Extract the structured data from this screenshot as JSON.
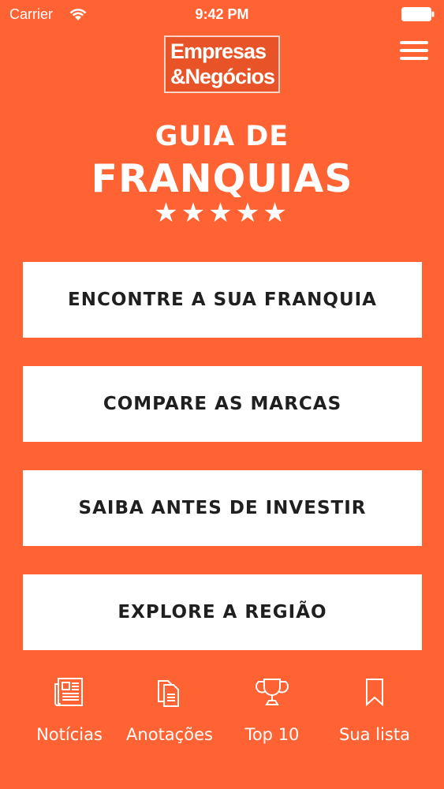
{
  "status_bar": {
    "carrier": "Carrier",
    "time": "9:42 PM"
  },
  "header": {
    "logo_line1": "Empresas",
    "logo_line2": "&Negócios"
  },
  "title": {
    "line1": "GUIA DE",
    "line2": "FRANQUIAS",
    "stars": "★★★★★"
  },
  "actions": [
    {
      "label": "ENCONTRE A SUA FRANQUIA"
    },
    {
      "label": "COMPARE AS MARCAS"
    },
    {
      "label": "SAIBA ANTES DE INVESTIR"
    },
    {
      "label": "EXPLORE A REGIÃO"
    }
  ],
  "tabs": [
    {
      "label": "Notícias",
      "icon": "newspaper-icon"
    },
    {
      "label": "Anotações",
      "icon": "documents-icon"
    },
    {
      "label": "Top 10",
      "icon": "trophy-icon"
    },
    {
      "label": "Sua lista",
      "icon": "bookmark-icon"
    }
  ],
  "colors": {
    "background": "#FF6233",
    "button_bg": "#FFFFFF",
    "button_text": "#1F1F1F"
  }
}
